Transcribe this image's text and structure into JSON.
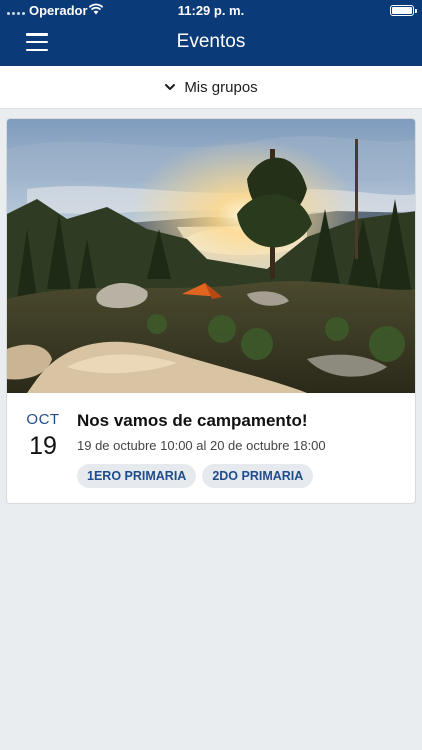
{
  "status_bar": {
    "carrier": "Operador",
    "time": "11:29 p. m."
  },
  "header": {
    "title": "Eventos"
  },
  "filter": {
    "label": "Mis grupos"
  },
  "event": {
    "month": "OCT",
    "day": "19",
    "title": "Nos vamos de campamento!",
    "datetime": "19 de octubre 10:00 al 20 de octubre 18:00",
    "tags": [
      "1ERO PRIMARIA",
      "2DO PRIMARIA"
    ]
  },
  "colors": {
    "header_bg": "#0b3a78",
    "accent": "#1f4d8c",
    "page_bg": "#eaedf0"
  }
}
